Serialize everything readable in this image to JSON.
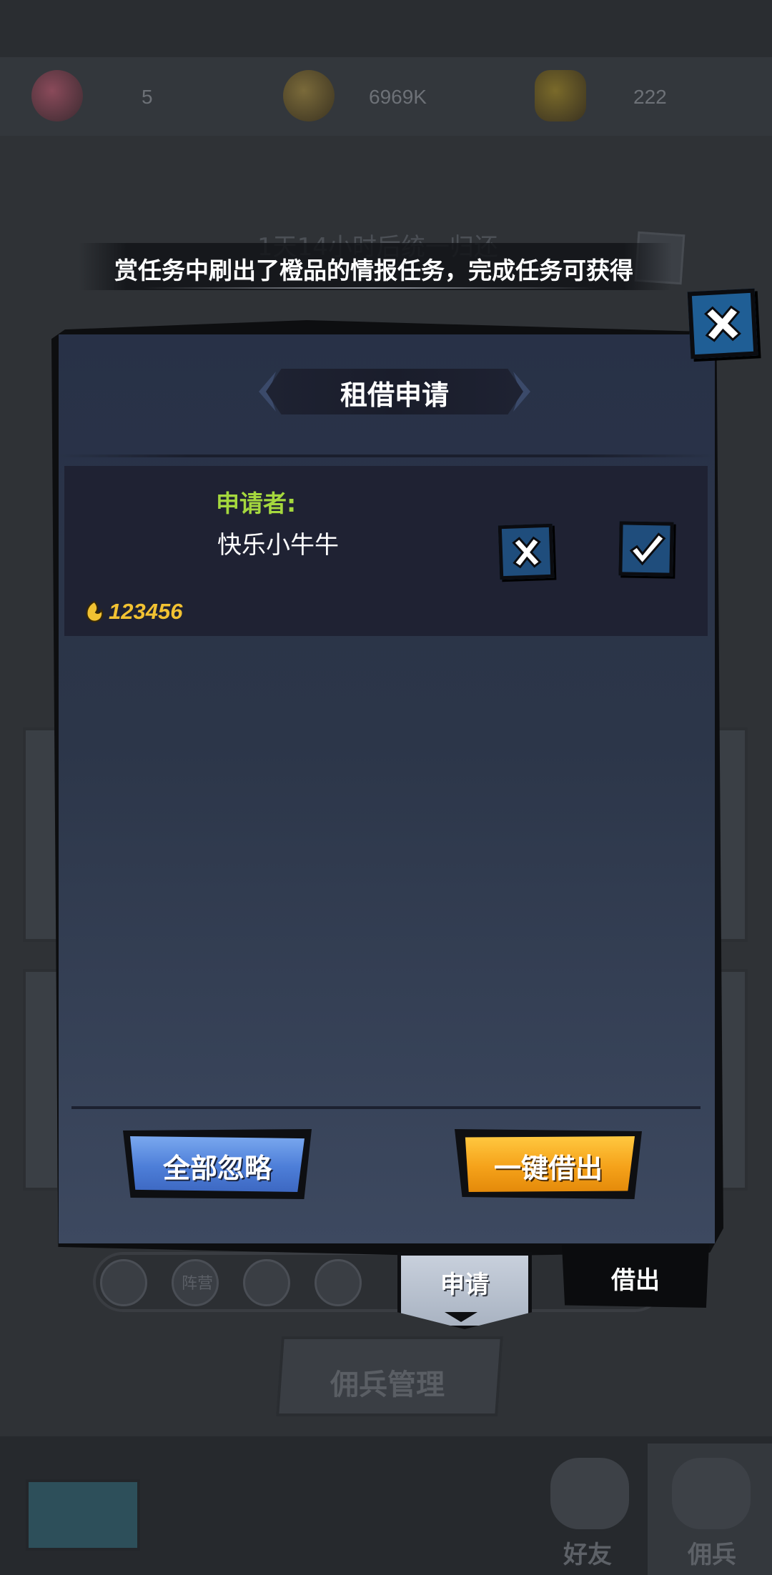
{
  "resources": [
    {
      "icon": "heart-stone-icon",
      "value": "5",
      "color": "#8a4a5a"
    },
    {
      "icon": "gold-coin-icon",
      "value": "6969K",
      "color": "#7a6a3a"
    },
    {
      "icon": "gold-key-icon",
      "value": "222",
      "color": "#7a6a2a"
    }
  ],
  "background": {
    "ghost_title": "1天14小时后统一归还",
    "mercenary_manage": "佣兵管理",
    "nav": {
      "friends": "好友",
      "mercenary": "佣兵"
    },
    "tab_small": "阵营"
  },
  "notice": {
    "text": "赏任务中刷出了橙品的情报任务，完成任务可获得"
  },
  "dialog": {
    "title": "租借申请",
    "request": {
      "applicant_label": "申请者:",
      "applicant_name": "快乐小牛牛",
      "score": "123456"
    },
    "buttons": {
      "ignore_all": "全部忽略",
      "lend_all": "一键借出"
    }
  },
  "tabs": {
    "apply": "申请",
    "lend": "借出"
  },
  "colors": {
    "accent_blue": "#1f5e95",
    "label_green": "#a5d83e",
    "score_gold": "#f2c232",
    "button_orange": "#f5a21a",
    "button_blue": "#4d7ed8"
  }
}
